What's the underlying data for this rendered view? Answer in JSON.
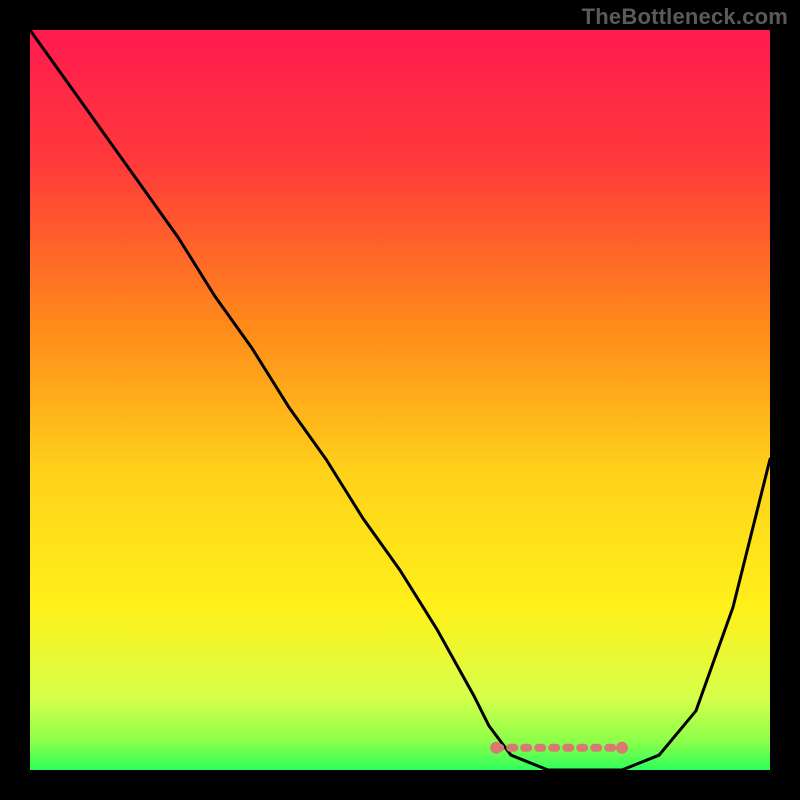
{
  "watermark": "TheBottleneck.com",
  "chart_data": {
    "type": "line",
    "title": "",
    "xlabel": "",
    "ylabel": "",
    "xlim": [
      0,
      100
    ],
    "ylim": [
      0,
      100
    ],
    "x": [
      0,
      5,
      10,
      15,
      20,
      25,
      30,
      35,
      40,
      45,
      50,
      55,
      60,
      62,
      65,
      70,
      75,
      80,
      85,
      90,
      95,
      100
    ],
    "values": [
      100,
      93,
      86,
      79,
      72,
      64,
      57,
      49,
      42,
      34,
      27,
      19,
      10,
      6,
      2,
      0,
      0,
      0,
      2,
      8,
      22,
      42
    ],
    "sweet_spot": {
      "start": 63,
      "end": 80,
      "y": 3
    },
    "gradient_stops": [
      {
        "pct": 0,
        "color": "#ff1a4f"
      },
      {
        "pct": 18,
        "color": "#ff3a3a"
      },
      {
        "pct": 40,
        "color": "#ff8a1a"
      },
      {
        "pct": 60,
        "color": "#ffd21a"
      },
      {
        "pct": 78,
        "color": "#fff01a"
      },
      {
        "pct": 90,
        "color": "#d8ff4a"
      },
      {
        "pct": 96,
        "color": "#8eff4a"
      },
      {
        "pct": 100,
        "color": "#2eff5a"
      }
    ]
  }
}
